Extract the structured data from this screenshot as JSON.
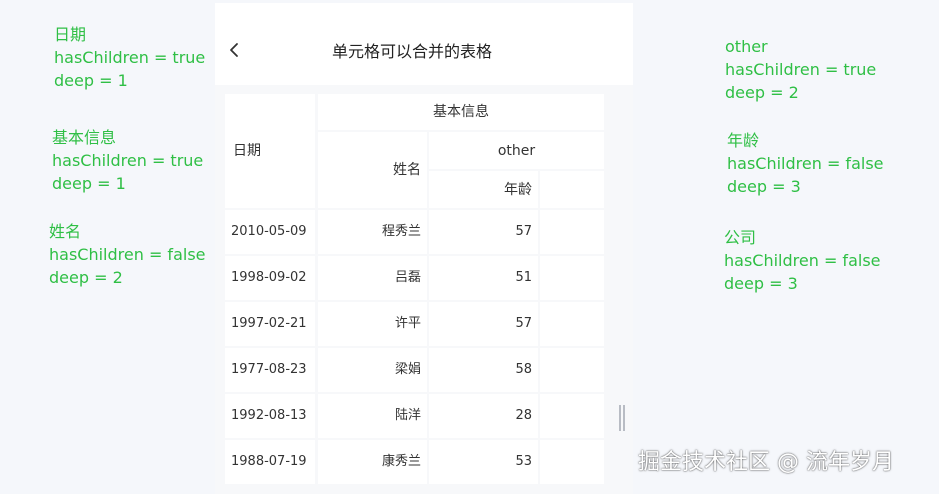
{
  "annotations_left": [
    {
      "title": "日期",
      "has_children": "hasChildren = true",
      "deep": "deep = 1"
    },
    {
      "title": "基本信息",
      "has_children": "hasChildren = true",
      "deep": "deep = 1"
    },
    {
      "title": "姓名",
      "has_children": "hasChildren = false",
      "deep": "deep = 2"
    }
  ],
  "annotations_right": [
    {
      "title": "other",
      "has_children": "hasChildren = true",
      "deep": "deep = 2"
    },
    {
      "title": "年龄",
      "has_children": "hasChildren = false",
      "deep": "deep = 3"
    },
    {
      "title": "公司",
      "has_children": "hasChildren = false",
      "deep": "deep = 3"
    }
  ],
  "navbar": {
    "title": "单元格可以合并的表格",
    "back_icon": "chevron-left-icon"
  },
  "table": {
    "headers": {
      "date": "日期",
      "basic_info": "基本信息",
      "name": "姓名",
      "other": "other",
      "age": "年龄"
    },
    "rows": [
      {
        "date": "2010-05-09",
        "name": "程秀兰",
        "age": "57"
      },
      {
        "date": "1998-09-02",
        "name": "吕磊",
        "age": "51"
      },
      {
        "date": "1997-02-21",
        "name": "许平",
        "age": "57"
      },
      {
        "date": "1977-08-23",
        "name": "梁娟",
        "age": "58"
      },
      {
        "date": "1992-08-13",
        "name": "陆洋",
        "age": "28"
      },
      {
        "date": "1988-07-19",
        "name": "康秀兰",
        "age": "53"
      }
    ]
  },
  "watermark": "掘金技术社区 @ 流年岁月",
  "colors": {
    "annotation": "#2fbf45",
    "page_bg": "#f5f7fb",
    "cell_bg": "#ffffff",
    "grid": "#f2f3f5"
  }
}
